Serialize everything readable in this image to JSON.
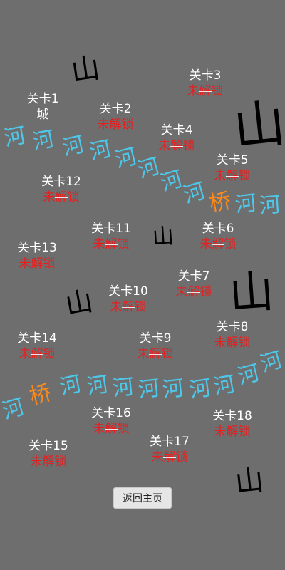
{
  "map": {
    "mountains": [
      "山",
      "山",
      "山",
      "山",
      "山",
      "山"
    ],
    "river_char": "河",
    "bridge_char": "桥"
  },
  "levels": [
    {
      "title": "关卡1",
      "status": "城",
      "locked": false
    },
    {
      "title": "关卡2",
      "status": "未解锁",
      "locked": true
    },
    {
      "title": "关卡3",
      "status": "未解锁",
      "locked": true
    },
    {
      "title": "关卡4",
      "status": "未解锁",
      "locked": true
    },
    {
      "title": "关卡5",
      "status": "未解锁",
      "locked": true
    },
    {
      "title": "关卡6",
      "status": "未解锁",
      "locked": true
    },
    {
      "title": "关卡7",
      "status": "未解锁",
      "locked": true
    },
    {
      "title": "关卡8",
      "status": "未解锁",
      "locked": true
    },
    {
      "title": "关卡9",
      "status": "未解锁",
      "locked": true
    },
    {
      "title": "关卡10",
      "status": "未解锁",
      "locked": true
    },
    {
      "title": "关卡11",
      "status": "未解锁",
      "locked": true
    },
    {
      "title": "关卡12",
      "status": "未解锁",
      "locked": true
    },
    {
      "title": "关卡13",
      "status": "未解锁",
      "locked": true
    },
    {
      "title": "关卡14",
      "status": "未解锁",
      "locked": true
    },
    {
      "title": "关卡15",
      "status": "未解锁",
      "locked": true
    },
    {
      "title": "关卡16",
      "status": "未解锁",
      "locked": true
    },
    {
      "title": "关卡17",
      "status": "未解锁",
      "locked": true
    },
    {
      "title": "关卡18",
      "status": "未解锁",
      "locked": true
    }
  ],
  "home_button": "返回主页"
}
